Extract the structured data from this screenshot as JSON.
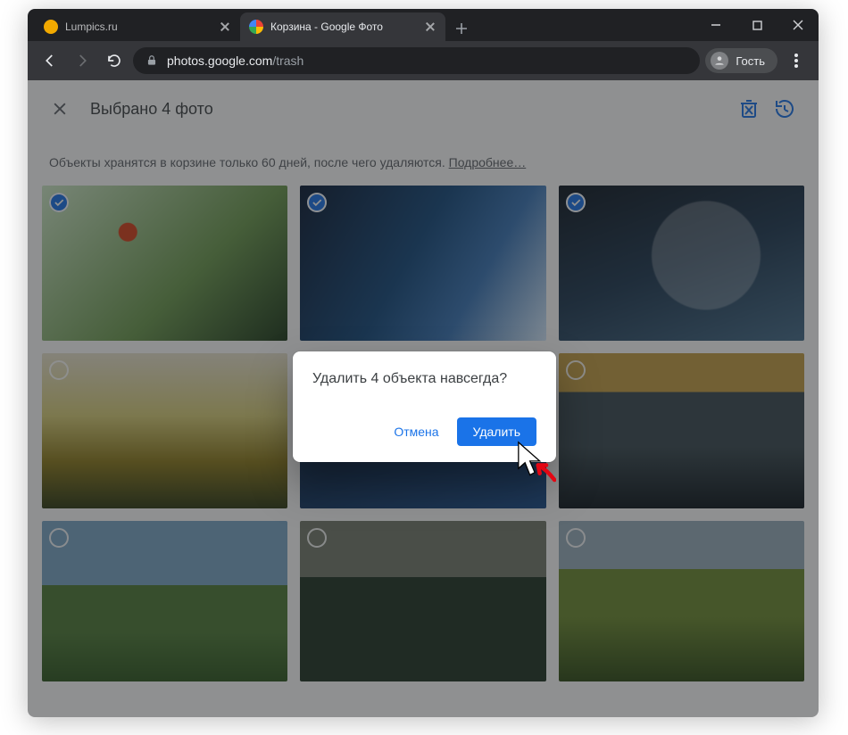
{
  "window": {
    "tabs": [
      {
        "title": "Lumpics.ru",
        "active": false,
        "favicon_color": "#f2a900"
      },
      {
        "title": "Корзина - Google Фото",
        "active": true,
        "favicon_color": "#ea4335"
      }
    ]
  },
  "toolbar": {
    "url_domain": "photos.google.com",
    "url_path": "/trash",
    "guest_label": "Гость"
  },
  "app_bar": {
    "title": "Выбрано 4 фото"
  },
  "notice": {
    "text": "Объекты хранятся в корзине только 60 дней, после чего удаляются. ",
    "link": "Подробнее…"
  },
  "photos": [
    {
      "id": "img-1",
      "selected": true
    },
    {
      "id": "img-2",
      "selected": true
    },
    {
      "id": "img-3",
      "selected": true
    },
    {
      "id": "img-4",
      "selected": false
    },
    {
      "id": "img-5",
      "selected": false
    },
    {
      "id": "img-6",
      "selected": false
    },
    {
      "id": "img-7",
      "selected": false
    },
    {
      "id": "img-8",
      "selected": false
    },
    {
      "id": "img-9",
      "selected": false
    }
  ],
  "dialog": {
    "message": "Удалить 4 объекта навсегда?",
    "cancel": "Отмена",
    "confirm": "Удалить"
  },
  "colors": {
    "accent": "#1a73e8",
    "highlight": "#e30613"
  }
}
